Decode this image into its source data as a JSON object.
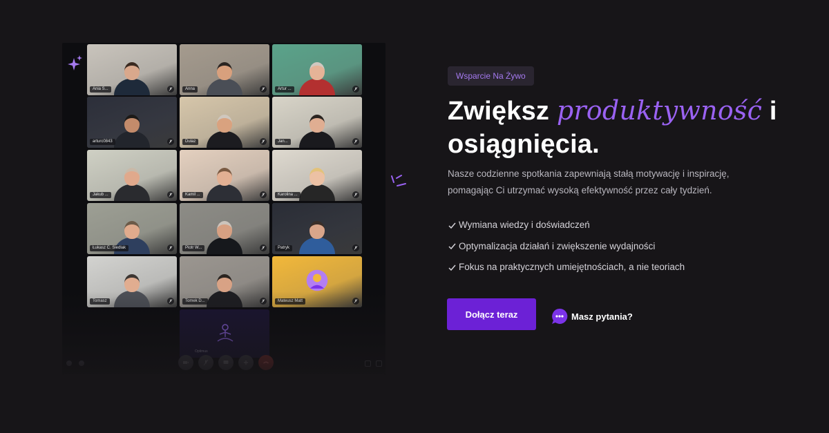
{
  "colors": {
    "background": "#171518",
    "accent": "#9a62f2",
    "button": "#6c21d6",
    "badge_bg": "#2a2530"
  },
  "call": {
    "participants": [
      {
        "name": "Ania S...",
        "room": "#c9c4bc",
        "skin": "#d9a88c",
        "shirt": "#1e2a3a",
        "hair": "#3a2a20"
      },
      {
        "name": "Anna",
        "room": "#a59b8e",
        "skin": "#d8a07d",
        "shirt": "#4a4e56",
        "hair": "#2b2522"
      },
      {
        "name": "Artur ...",
        "room": "#5aa38a",
        "skin": "#e5b397",
        "shirt": "#b33030",
        "hair": "#d0c8c0"
      },
      {
        "name": "arturc0843",
        "room": "#2c2f3a",
        "skin": "#c38b6b",
        "shirt": "#22252c",
        "hair": "#1c1a18"
      },
      {
        "name": "Dulaz",
        "room": "#d6c6aa",
        "skin": "#d9a27f",
        "shirt": "#1c1c20",
        "hair": "#cfc7be"
      },
      {
        "name": "Jan...",
        "room": "#d8d4c8",
        "skin": "#e0ae92",
        "shirt": "#1a1a1e",
        "hair": "#2a2420"
      },
      {
        "name": "Jakub ...",
        "room": "#cfd0c4",
        "skin": "#e0a98c",
        "shirt": "#2a2b2f",
        "hair": "#c9b9a8"
      },
      {
        "name": "Kamil ...",
        "room": "#e4d0bf",
        "skin": "#e2b093",
        "shirt": "#2d2f36",
        "hair": "#7a5a42"
      },
      {
        "name": "Karolina ...",
        "room": "#ded9cf",
        "skin": "#ecc1a4",
        "shirt": "#262626",
        "hair": "#e3c27a"
      },
      {
        "name": "Łukasz C. Siedlak",
        "room": "#9d9f94",
        "skin": "#e0ab8d",
        "shirt": "#2e3f5e",
        "hair": "#6b5a48"
      },
      {
        "name": "Piotr W...",
        "room": "#8d8c86",
        "skin": "#d7a082",
        "shirt": "#16181c",
        "hair": "#ccc4bc"
      },
      {
        "name": "Patryk",
        "room": "#2a2d36",
        "skin": "#d9a58a",
        "shirt": "#2f5d9c",
        "hair": "#3a2e28"
      },
      {
        "name": "Tomasz",
        "room": "#d3d3d0",
        "skin": "#e1ad90",
        "shirt": "#4d5057",
        "hair": "#3c3632"
      },
      {
        "name": "Tomek D...",
        "room": "#9b9690",
        "skin": "#d8a285",
        "shirt": "#1e1e22",
        "hair": "#2a2420"
      },
      {
        "name": "Mateusz Matt",
        "room": "#f2b83a",
        "skin": "",
        "shirt": "",
        "hair": ""
      }
    ],
    "bottom_tile_label": "Optimus"
  },
  "badge": "Wsparcie Na Żywo",
  "headline": {
    "part1": "Zwiększ ",
    "accent": "produktywność",
    "part2": " i osiągnięcia."
  },
  "description": "Nasze codzienne spotkania zapewniają stałą motywację i inspirację, pomagając Ci utrzymać wysoką efektywność przez cały tydzień.",
  "features": [
    "Wymiana wiedzy i doświadczeń",
    "Optymalizacja działań i zwiększenie wydajności",
    "Fokus na praktycznych umiejętnościach, a nie teoriach"
  ],
  "cta": {
    "join_label": "Dołącz teraz",
    "ask_label": "Masz pytania?"
  },
  "icons": {
    "feature": "check-icon",
    "ask": "chat-bubble-icon",
    "sparkle": "sparkle-icon"
  }
}
